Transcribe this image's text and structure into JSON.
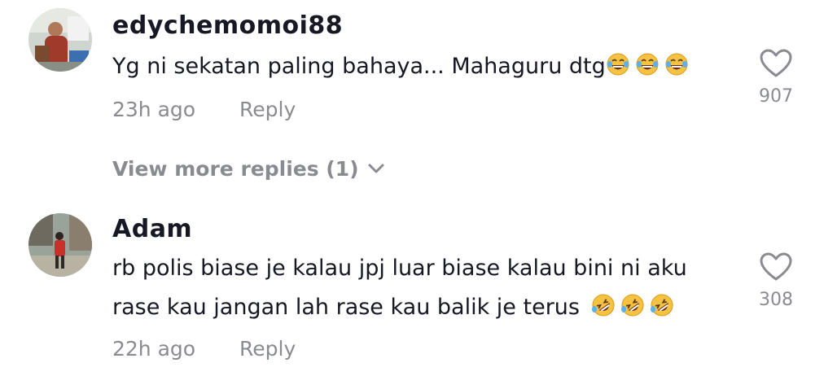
{
  "comments": [
    {
      "username": "edychemomoi88",
      "text_lines": [
        "Yg ni sekatan paling bahaya... Mahaguru dtg"
      ],
      "emojis": [
        "face-with-tears-of-joy",
        "face-with-tears-of-joy",
        "face-with-tears-of-joy"
      ],
      "time": "23h ago",
      "reply_label": "Reply",
      "like_count": "907",
      "view_more_replies": "View more replies (1)"
    },
    {
      "username": "Adam",
      "text_lines": [
        "rb polis biase je kalau jpj luar biase kalau bini ni aku",
        "rase kau jangan lah rase kau balik je terus"
      ],
      "emojis": [
        "rolling-on-the-floor-laughing",
        "rolling-on-the-floor-laughing",
        "rolling-on-the-floor-laughing"
      ],
      "time": "22h ago",
      "reply_label": "Reply",
      "like_count": "308"
    }
  ],
  "colors": {
    "text": "#161823",
    "muted": "#8a8b91",
    "background": "#ffffff"
  }
}
